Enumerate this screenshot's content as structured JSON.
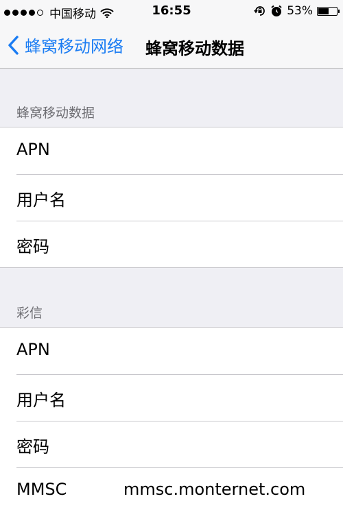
{
  "status_bar": {
    "carrier": "中国移动",
    "time": "16:55",
    "battery_percent": "53%",
    "battery_level": 0.53,
    "icons": [
      "signal-dots-icon",
      "wifi-icon",
      "rotation-lock-icon",
      "alarm-icon",
      "battery-icon"
    ]
  },
  "navbar": {
    "back_label": "蜂窝移动网络",
    "title": "蜂窝移动数据",
    "accent_color": "#1a7cf3"
  },
  "sections": [
    {
      "header": "蜂窝移动数据",
      "rows": [
        {
          "label": "APN",
          "value": ""
        },
        {
          "label": "用户名",
          "value": ""
        },
        {
          "label": "密码",
          "value": ""
        }
      ]
    },
    {
      "header": "彩信",
      "rows": [
        {
          "label": "APN",
          "value": ""
        },
        {
          "label": "用户名",
          "value": ""
        },
        {
          "label": "密码",
          "value": ""
        },
        {
          "label": "MMSC",
          "value": "mmsc.monternet.com"
        }
      ]
    }
  ]
}
